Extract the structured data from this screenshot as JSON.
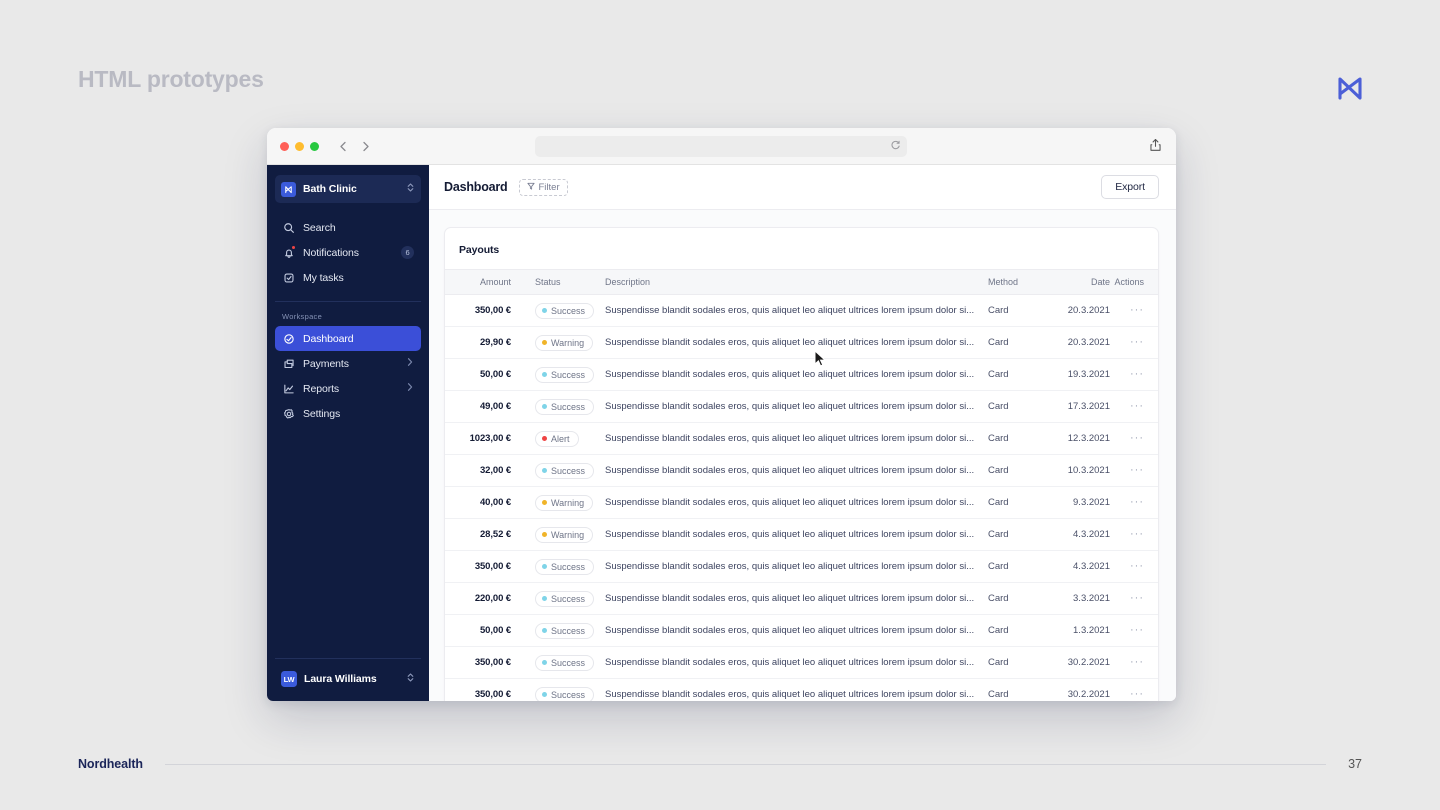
{
  "slide": {
    "title": "HTML prototypes",
    "logo_icon": "nordhealth-n-logo",
    "logo_color": "#4c5fd7",
    "footer_brand": "Nordhealth",
    "page_number": "37"
  },
  "browser": {
    "traffic_lights": [
      "close",
      "minimize",
      "maximize"
    ],
    "back_icon": "chevron-left-icon",
    "forward_icon": "chevron-right-icon",
    "url_value": "",
    "url_placeholder": "",
    "reload_icon": "reload-icon",
    "share_icon": "share-icon"
  },
  "sidebar": {
    "org": {
      "name": "Bath Clinic",
      "mark_icon": "nordhealth-n-logo",
      "switch_icon": "chevron-up-down-icon",
      "accent": "#3b5bdb"
    },
    "top_items": [
      {
        "label": "Search",
        "icon": "search-icon",
        "badge": null,
        "dot": false
      },
      {
        "label": "Notifications",
        "icon": "bell-icon",
        "badge": "6",
        "dot": true
      },
      {
        "label": "My tasks",
        "icon": "task-check-icon",
        "badge": null,
        "dot": false
      }
    ],
    "section_label": "Workspace",
    "workspace_items": [
      {
        "label": "Dashboard",
        "icon": "dashboard-circle-check-icon",
        "active": true,
        "chevron": false
      },
      {
        "label": "Payments",
        "icon": "payments-card-icon",
        "active": false,
        "chevron": true
      },
      {
        "label": "Reports",
        "icon": "reports-chart-icon",
        "active": false,
        "chevron": true
      },
      {
        "label": "Settings",
        "icon": "gear-icon",
        "active": false,
        "chevron": false
      }
    ],
    "user": {
      "initials": "LW",
      "name": "Laura Williams",
      "switch_icon": "chevron-up-down-icon"
    },
    "bg_color": "#101c40",
    "active_color": "#3b4fd8"
  },
  "topbar": {
    "page_title": "Dashboard",
    "filter_label": "Filter",
    "filter_icon": "funnel-icon",
    "export_label": "Export"
  },
  "table": {
    "card_title": "Payouts",
    "columns": [
      "Amount",
      "Status",
      "Description",
      "Method",
      "Date",
      "Actions"
    ],
    "status_colors": {
      "Success": "#7fd4e8",
      "Warning": "#f0b429",
      "Alert": "#ef4444"
    },
    "actions_icon": "kebab-dots-icon",
    "rows": [
      {
        "amount": "350,00 €",
        "status": "Success",
        "description": "Suspendisse blandit sodales eros, quis aliquet leo aliquet ultrices lorem ipsum dolor si...",
        "method": "Card",
        "date": "20.3.2021",
        "actions": "···"
      },
      {
        "amount": "29,90 €",
        "status": "Warning",
        "description": "Suspendisse blandit sodales eros, quis aliquet leo aliquet ultrices lorem ipsum dolor si...",
        "method": "Card",
        "date": "20.3.2021",
        "actions": "···"
      },
      {
        "amount": "50,00 €",
        "status": "Success",
        "description": "Suspendisse blandit sodales eros, quis aliquet leo aliquet ultrices lorem ipsum dolor si...",
        "method": "Card",
        "date": "19.3.2021",
        "actions": "···"
      },
      {
        "amount": "49,00 €",
        "status": "Success",
        "description": "Suspendisse blandit sodales eros, quis aliquet leo aliquet ultrices lorem ipsum dolor si...",
        "method": "Card",
        "date": "17.3.2021",
        "actions": "···"
      },
      {
        "amount": "1023,00 €",
        "status": "Alert",
        "description": "Suspendisse blandit sodales eros, quis aliquet leo aliquet ultrices lorem ipsum dolor si...",
        "method": "Card",
        "date": "12.3.2021",
        "actions": "···"
      },
      {
        "amount": "32,00 €",
        "status": "Success",
        "description": "Suspendisse blandit sodales eros, quis aliquet leo aliquet ultrices lorem ipsum dolor si...",
        "method": "Card",
        "date": "10.3.2021",
        "actions": "···"
      },
      {
        "amount": "40,00 €",
        "status": "Warning",
        "description": "Suspendisse blandit sodales eros, quis aliquet leo aliquet ultrices lorem ipsum dolor si...",
        "method": "Card",
        "date": "9.3.2021",
        "actions": "···"
      },
      {
        "amount": "28,52 €",
        "status": "Warning",
        "description": "Suspendisse blandit sodales eros, quis aliquet leo aliquet ultrices lorem ipsum dolor si...",
        "method": "Card",
        "date": "4.3.2021",
        "actions": "···"
      },
      {
        "amount": "350,00 €",
        "status": "Success",
        "description": "Suspendisse blandit sodales eros, quis aliquet leo aliquet ultrices lorem ipsum dolor si...",
        "method": "Card",
        "date": "4.3.2021",
        "actions": "···"
      },
      {
        "amount": "220,00 €",
        "status": "Success",
        "description": "Suspendisse blandit sodales eros, quis aliquet leo aliquet ultrices lorem ipsum dolor si...",
        "method": "Card",
        "date": "3.3.2021",
        "actions": "···"
      },
      {
        "amount": "50,00 €",
        "status": "Success",
        "description": "Suspendisse blandit sodales eros, quis aliquet leo aliquet ultrices lorem ipsum dolor si...",
        "method": "Card",
        "date": "1.3.2021",
        "actions": "···"
      },
      {
        "amount": "350,00 €",
        "status": "Success",
        "description": "Suspendisse blandit sodales eros, quis aliquet leo aliquet ultrices lorem ipsum dolor si...",
        "method": "Card",
        "date": "30.2.2021",
        "actions": "···"
      },
      {
        "amount": "350,00 €",
        "status": "Success",
        "description": "Suspendisse blandit sodales eros, quis aliquet leo aliquet ultrices lorem ipsum dolor si...",
        "method": "Card",
        "date": "30.2.2021",
        "actions": "···"
      }
    ]
  }
}
